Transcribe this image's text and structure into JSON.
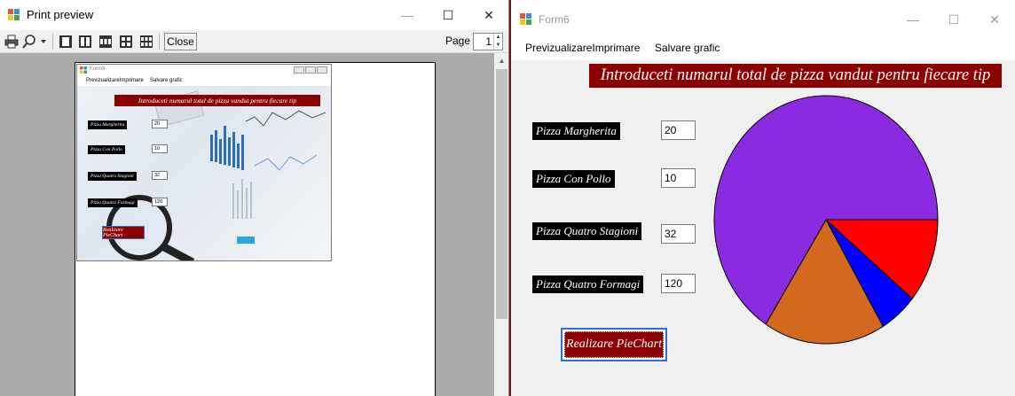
{
  "print_preview": {
    "title": "Print preview",
    "close_label": "Close",
    "page_label": "Page",
    "page_value": "1",
    "caption": {
      "minimize": "—",
      "maximize": "☐",
      "close": "✕"
    },
    "toolbar_icons": [
      "print-icon",
      "zoom-icon",
      "one-page-icon",
      "two-pages-icon",
      "three-pages-icon",
      "four-pages-icon",
      "six-pages-icon"
    ]
  },
  "thumbnail": {
    "title": "Form6",
    "menu": [
      "PrevizualizareImprimare",
      "Salvare grafic"
    ],
    "header": "Introduceti numarul total de pizza vandut pentru fiecare tip",
    "labels": [
      "Pizza Margherita",
      "Pizza Con Pollo",
      "Pizza Quatro Stagioni",
      "Pizza Quatro Formagi"
    ],
    "values": [
      "20",
      "10",
      "32",
      "120"
    ],
    "button": "Realizare PieChart"
  },
  "form": {
    "title": "Form6",
    "menu": {
      "preview": "PrevizualizareImprimare",
      "save_chart": "Salvare grafic"
    },
    "header": "Introduceti numarul total de pizza vandut pentru fiecare tip",
    "fields": [
      {
        "label": "Pizza Margherita",
        "value": "20"
      },
      {
        "label": "Pizza Con Pollo",
        "value": "10"
      },
      {
        "label": "Pizza Quatro Stagioni",
        "value": "32"
      },
      {
        "label": "Pizza Quatro Formagi",
        "value": "120"
      }
    ],
    "button_label": "Realizare PieChart",
    "caption": {
      "minimize": "—",
      "maximize": "☐",
      "close": "✕"
    }
  },
  "colors": {
    "header_bg": "#8b0000",
    "accent_blue": "#2b6fd8"
  },
  "chart_data": {
    "type": "pie",
    "categories": [
      "Pizza Margherita",
      "Pizza Con Pollo",
      "Pizza Quatro Stagioni",
      "Pizza Quatro Formagi"
    ],
    "values": [
      20,
      10,
      32,
      120
    ],
    "colors": [
      "#ff0000",
      "#0000ff",
      "#d2691e",
      "#8a2be2"
    ],
    "start_angle_deg": 0,
    "direction": "clockwise"
  }
}
